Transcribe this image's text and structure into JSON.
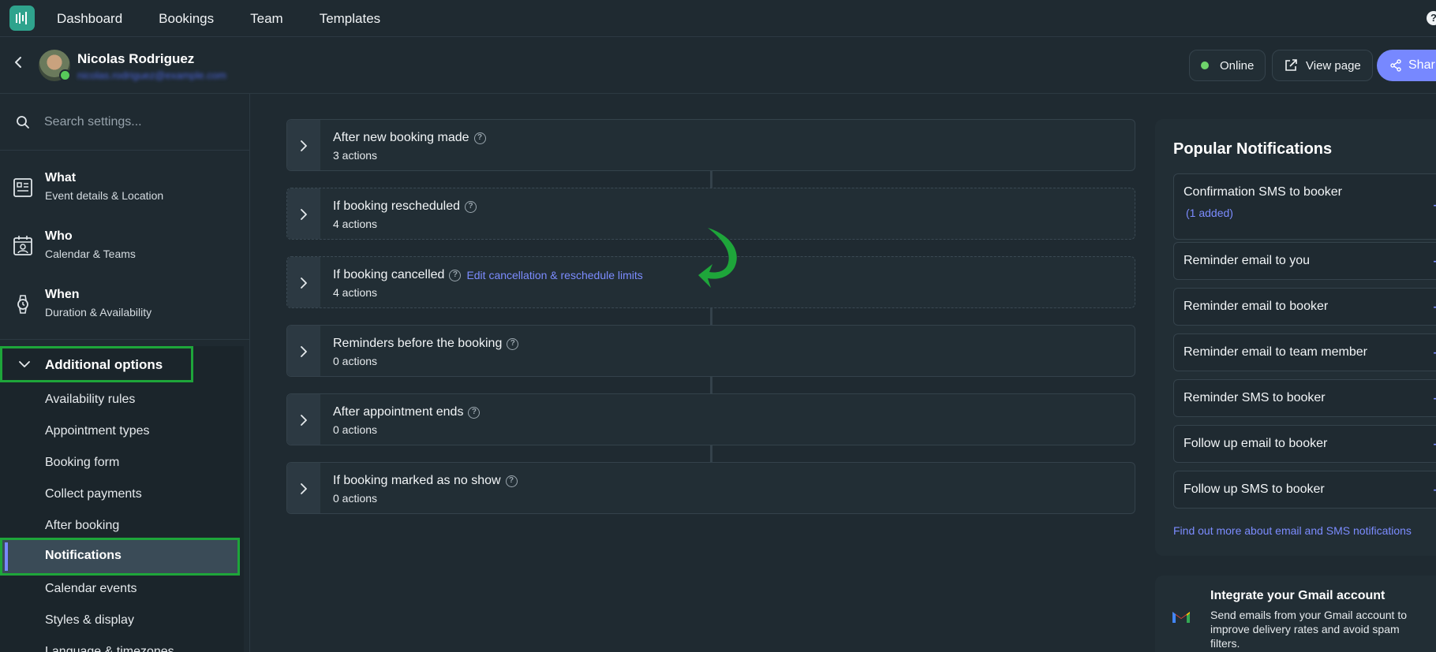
{
  "nav": {
    "links": [
      "Dashboard",
      "Bookings",
      "Team",
      "Templates"
    ],
    "help_label": "?"
  },
  "header": {
    "user_name": "Nicolas Rodriguez",
    "user_email": "nicolas.rodriguez@example.com",
    "online_label": "Online",
    "view_page_label": "View page",
    "share_label": "Shar"
  },
  "sidebar": {
    "search_placeholder": "Search settings...",
    "sections": [
      {
        "title": "What",
        "subtitle": "Event details & Location",
        "icon": "id-card-icon"
      },
      {
        "title": "Who",
        "subtitle": "Calendar & Teams",
        "icon": "calendar-user-icon"
      },
      {
        "title": "When",
        "subtitle": "Duration & Availability",
        "icon": "watch-icon"
      }
    ],
    "additional_label": "Additional options",
    "sub_items": [
      "Availability rules",
      "Appointment types",
      "Booking form",
      "Collect payments",
      "After booking",
      "Notifications",
      "Calendar events",
      "Styles & display",
      "Language & timezones"
    ],
    "active_item": "Notifications"
  },
  "triggers": [
    {
      "title": "After new booking made",
      "actions": "3 actions"
    },
    {
      "title": "If booking rescheduled",
      "actions": "4 actions"
    },
    {
      "title": "If booking cancelled",
      "actions": "4 actions",
      "link": "Edit cancellation & reschedule limits"
    },
    {
      "title": "Reminders before the booking",
      "actions": "0 actions"
    },
    {
      "title": "After appointment ends",
      "actions": "0 actions"
    },
    {
      "title": "If booking marked as no show",
      "actions": "0 actions"
    }
  ],
  "popular": {
    "title": "Popular Notifications",
    "items": [
      {
        "label": "Confirmation SMS to booker",
        "added": "(1 added)"
      },
      {
        "label": "Reminder email to you"
      },
      {
        "label": "Reminder email to booker"
      },
      {
        "label": "Reminder email to team member"
      },
      {
        "label": "Reminder SMS to booker"
      },
      {
        "label": "Follow up email to booker"
      },
      {
        "label": "Follow up SMS to booker"
      }
    ],
    "link": "Find out more about email and SMS notifications"
  },
  "gmail": {
    "title": "Integrate your Gmail account",
    "description": "Send emails from your Gmail account to improve delivery rates and avoid spam filters."
  },
  "colors": {
    "accent": "#7788ff",
    "highlight_box": "#1ea53a",
    "online": "#6fd36b",
    "background": "#1f2a31"
  }
}
